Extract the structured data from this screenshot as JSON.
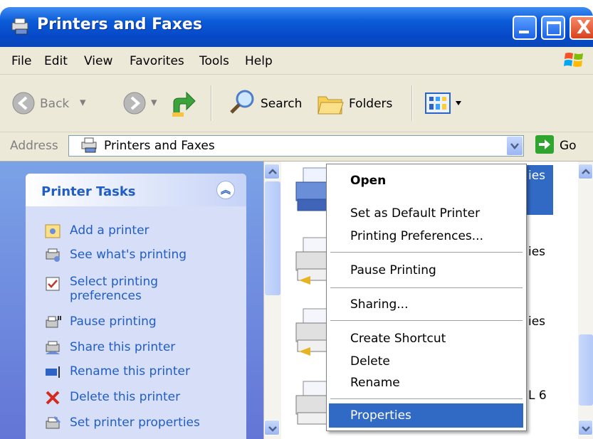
{
  "window": {
    "title": "Printers and Faxes",
    "close_glyph": "X"
  },
  "menu": [
    "File",
    "Edit",
    "View",
    "Favorites",
    "Tools",
    "Help"
  ],
  "toolbar": {
    "back_label": "Back",
    "search_label": "Search",
    "folders_label": "Folders"
  },
  "address": {
    "label": "Address",
    "value": "Printers and Faxes",
    "go_label": "Go"
  },
  "task_pane": {
    "title": "Printer Tasks",
    "items": [
      "Add a printer",
      "See what's printing",
      "Select printing",
      "preferences",
      "Pause printing",
      "Share this printer",
      "Rename this printer",
      "Delete this printer",
      "Set printer properties"
    ]
  },
  "content_fragments": [
    "ies",
    "ies",
    "ies",
    "L 6"
  ],
  "context_menu": {
    "items": [
      "Open",
      "Set as Default Printer",
      "Printing Preferences...",
      "Pause Printing",
      "Sharing...",
      "Create Shortcut",
      "Delete",
      "Rename",
      "Properties"
    ],
    "highlighted": "Properties"
  },
  "colors": {
    "titlebar": "#0648c7",
    "selection": "#316ac5",
    "task_link": "#215dc6"
  }
}
